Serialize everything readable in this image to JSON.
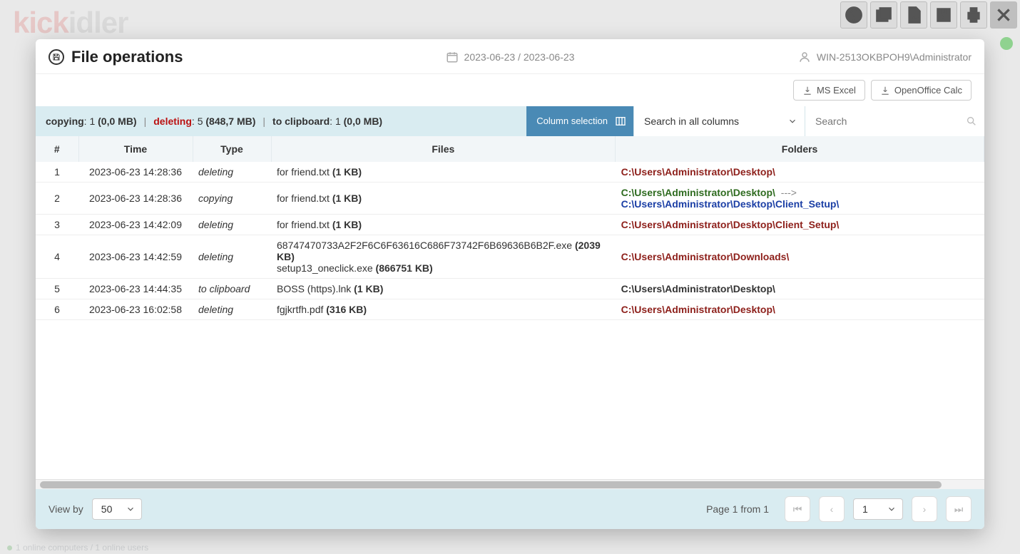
{
  "background": {
    "logo_red": "kick",
    "logo_grey": "idler",
    "status": "1 online computers / 1 online users"
  },
  "toolbar": {
    "icons": [
      "help",
      "window",
      "pdf",
      "zip",
      "print",
      "close"
    ]
  },
  "header": {
    "title": "File operations",
    "date_label": "2023-06-23 / 2023-06-23",
    "user_label": "WIN-2513OKBPOH9\\Administrator"
  },
  "export": {
    "ms_excel": "MS Excel",
    "oo_calc": "OpenOffice Calc"
  },
  "summary": {
    "copying_label": "copying",
    "copying_count": "1",
    "copying_size": "(0,0 MB)",
    "deleting_label": "deleting",
    "deleting_count": "5",
    "deleting_size": "(848,7 MB)",
    "clipboard_label": "to clipboard",
    "clipboard_count": "1",
    "clipboard_size": "(0,0 MB)"
  },
  "controls": {
    "column_selection": "Column selection",
    "search_scope": "Search in all columns",
    "search_placeholder": "Search"
  },
  "columns": {
    "c1": "#",
    "c2": "Time",
    "c3": "Type",
    "c4": "Files",
    "c5": "Folders"
  },
  "rows": [
    {
      "n": "1",
      "time": "2023-06-23 14:28:36",
      "type": "deleting",
      "files": [
        {
          "name": "for friend.txt",
          "size": "(1 KB)"
        }
      ],
      "folder_mode": "del",
      "folder": "C:\\Users\\Administrator\\Desktop\\"
    },
    {
      "n": "2",
      "time": "2023-06-23 14:28:36",
      "type": "copying",
      "files": [
        {
          "name": "for friend.txt",
          "size": "(1 KB)"
        }
      ],
      "folder_mode": "copy",
      "src": "C:\\Users\\Administrator\\Desktop\\",
      "dst": "C:\\Users\\Administrator\\Desktop\\Client_Setup\\"
    },
    {
      "n": "3",
      "time": "2023-06-23 14:42:09",
      "type": "deleting",
      "files": [
        {
          "name": "for friend.txt",
          "size": "(1 KB)"
        }
      ],
      "folder_mode": "del",
      "folder": "C:\\Users\\Administrator\\Desktop\\Client_Setup\\"
    },
    {
      "n": "4",
      "time": "2023-06-23 14:42:59",
      "type": "deleting",
      "files": [
        {
          "name": "68747470733A2F2F6C6F63616C686F73742F6B69636B6B2F.exe",
          "size": "(2039 KB)"
        },
        {
          "name": "setup13_oneclick.exe",
          "size": "(866751 KB)"
        }
      ],
      "folder_mode": "del",
      "folder": "C:\\Users\\Administrator\\Downloads\\"
    },
    {
      "n": "5",
      "time": "2023-06-23 14:44:35",
      "type": "to clipboard",
      "files": [
        {
          "name": "BOSS (https).lnk",
          "size": "(1 KB)"
        }
      ],
      "folder_mode": "plain",
      "folder": "C:\\Users\\Administrator\\Desktop\\"
    },
    {
      "n": "6",
      "time": "2023-06-23 16:02:58",
      "type": "deleting",
      "files": [
        {
          "name": "fgjkrtfh.pdf",
          "size": "(316 KB)"
        }
      ],
      "folder_mode": "del",
      "folder": "C:\\Users\\Administrator\\Desktop\\"
    }
  ],
  "folder_arrow": " ---> ",
  "footer": {
    "view_by": "View by",
    "per_page": "50",
    "page_label": "Page 1 from 1",
    "current_page": "1"
  }
}
